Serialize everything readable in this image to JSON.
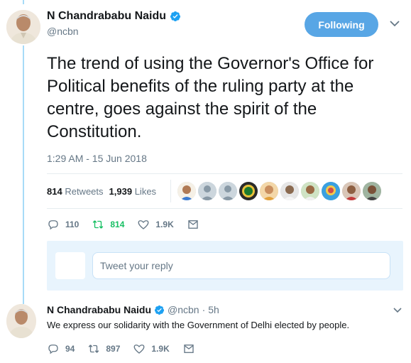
{
  "main_tweet": {
    "display_name": "N Chandrababu Naidu",
    "handle": "@ncbn",
    "follow_label": "Following",
    "text": "The trend of using the Governor's Office for Political benefits of the ruling party at the centre, goes against the spirit of the Constitution.",
    "timestamp": "1:29 AM - 15 Jun 2018",
    "retweets_count": "814",
    "retweets_label": "Retweets",
    "likes_count": "1,939",
    "likes_label": "Likes",
    "actions": {
      "replies": "110",
      "retweets": "814",
      "likes": "1.9K"
    }
  },
  "reply_box": {
    "placeholder": "Tweet your reply"
  },
  "second_tweet": {
    "display_name": "N Chandrababu Naidu",
    "handle": "@ncbn",
    "separator": "·",
    "time": "5h",
    "text": "We express our solidarity with the Government of Delhi elected by people.",
    "actions": {
      "replies": "94",
      "retweets": "897",
      "likes": "1.9K"
    }
  },
  "colors": {
    "accent": "#1da1f2",
    "follow_button": "#58a6e5",
    "retweet_green": "#17bf63",
    "muted": "#657786",
    "thread_line": "#a7dbf7",
    "reply_box_bg": "#e8f4fd"
  },
  "icons": {
    "verified": "verified-badge-icon",
    "reply": "reply-icon",
    "retweet": "retweet-icon",
    "like": "heart-icon",
    "dm": "envelope-icon",
    "caret": "chevron-down-icon"
  }
}
